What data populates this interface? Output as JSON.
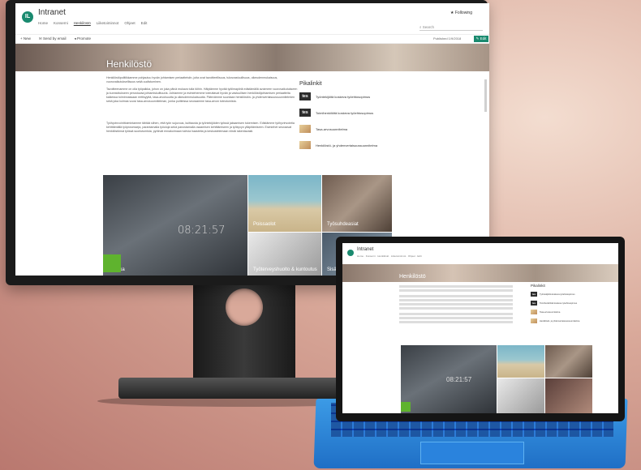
{
  "site": {
    "logo": "IL",
    "title": "Intranet",
    "nav": [
      "Home",
      "Konserni",
      "Henkilöstö",
      "Liiketoiminnot",
      "Ohjeet",
      "Edit"
    ],
    "active_nav_index": 2,
    "following": "Following",
    "search_placeholder": "Search"
  },
  "command_bar": {
    "new": "New",
    "send_email": "Send by email",
    "promote": "Promote",
    "published": "Published 1/9/2018",
    "edit": "Edit"
  },
  "page": {
    "title": "Henkilöstö",
    "paragraphs": [
      "Henkilöstöpolitiikkamme pohjautuu hyvän johtamisen periaatteisiin, joita ovat tavoitteellisuus, tulosvastuullisuus, oikeudenmukaisuus, vuorovaikutuksellisuus sekä uudistuminen.",
      "Tavoitteenamme on olla työpaikka, johon on joka päivä mukava tulla töihin. Hälytämme hyvää työilmapiiriä edistämällä avoimeen vuorovaikutukseen ja kunnioitukseen perustuvaa johtamiskulttuuria. Johtamme ja esimiehemme toteuttavat hyvän ja vastuullisen henkilöstöjohtamisen periaatteita kaikessa toiminnassaan eettisyyttä, tasa-arvoisuutta ja oikeudenmukaisuutta. Pätevämme suuntaan henkilöstön- ja yhdenvertaisuussuunnitelmien sekä joka kolmas vuosi tasa-arvosuunnitelman, jonka puitteissa seuraamme tasa-arvon toteutumista.",
      "Työhyvinvointitoimintamme tähtää siihen, että työn sujuvuus, kuittausta ja työntekijöiden työssä jaksamisen tukemisen. Edistämme työhyvinvointia kehittämällä työprosesseja, parantamalla työoloja sekä panostamalla osaamisen kehittämiseen ja työkyvyn ylläpitämiseen. Esimiehet seuraavat henkilöstönsä työssä suoriutumista, pyrkivät ennakoimaan tulevia haasteita ja keskustelemaan niistä rakentavasti."
    ]
  },
  "quick_links": {
    "title": "Pikalinkit",
    "items": [
      {
        "icon": "tes",
        "label": "Työntekijöitä koskeva työehtosopimus"
      },
      {
        "icon": "tes",
        "label": "Toimihenkilöitä koskeva työehtosopimus"
      },
      {
        "icon": "thumb",
        "label": "Tasa-arvosuunnitelma"
      },
      {
        "icon": "thumb",
        "label": "Henkilöstö- ja yhdenvertaisuussuunnitelma"
      }
    ]
  },
  "tiles": {
    "clock": "08:21:57",
    "items": [
      "Työaika",
      "Poissaolot",
      "Työsuhdeasiat",
      "Työterveyshuolto & kuntoutus",
      "Sisäinen viestintä"
    ]
  },
  "colors": {
    "brand": "#1a8a6f",
    "accent_green": "#5fb32e",
    "keyboard_blue": "#2a83dd"
  }
}
